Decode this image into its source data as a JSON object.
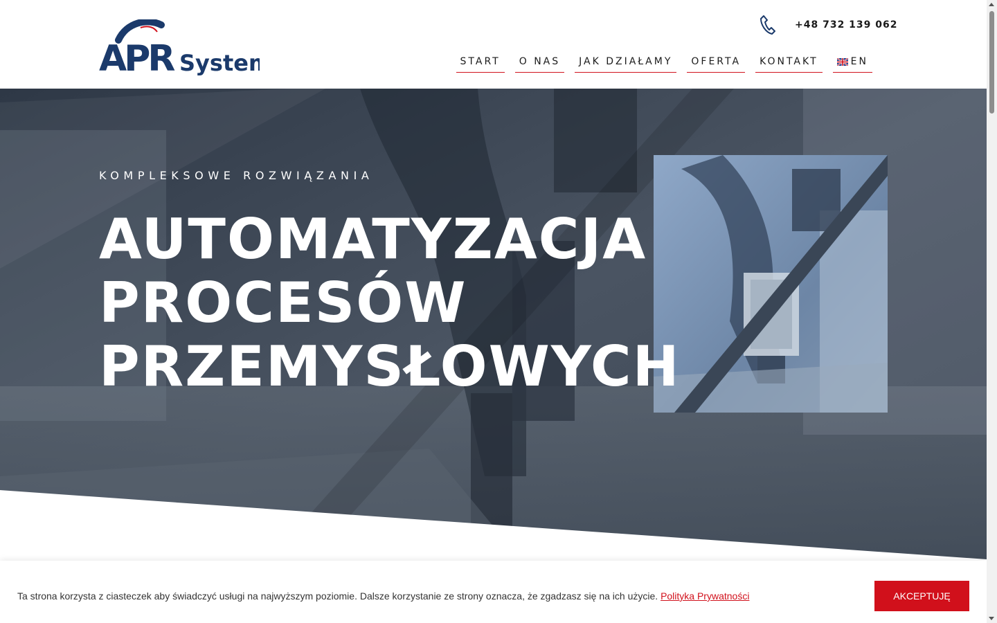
{
  "header": {
    "logo_text": "APR System",
    "phone": "+48 732 139 062",
    "nav": [
      {
        "label": "START"
      },
      {
        "label": "O NAS"
      },
      {
        "label": "JAK DZIAŁAMY"
      },
      {
        "label": "OFERTA"
      },
      {
        "label": "KONTAKT"
      },
      {
        "label": "EN"
      }
    ]
  },
  "hero": {
    "eyebrow": "KOMPLEKSOWE ROZWIĄZANIA",
    "headline": [
      "AUTOMATYZACJA",
      "PROCESÓW",
      "PRZEMYSŁOWYCH"
    ]
  },
  "cookie": {
    "text": "Ta strona korzysta z ciasteczek aby świadczyć usługi na najwyższym poziomie. Dalsze korzystanie ze strony oznacza, że zgadzasz się na ich użycie.",
    "link": "Polityka Prywatności",
    "button": "AKCEPTUJĘ"
  },
  "colors": {
    "brand_blue": "#1b3a6b",
    "accent_red": "#d1101b",
    "hero_overlay": "#2b3542"
  },
  "icons": [
    "phone-icon",
    "uk-flag-icon"
  ]
}
